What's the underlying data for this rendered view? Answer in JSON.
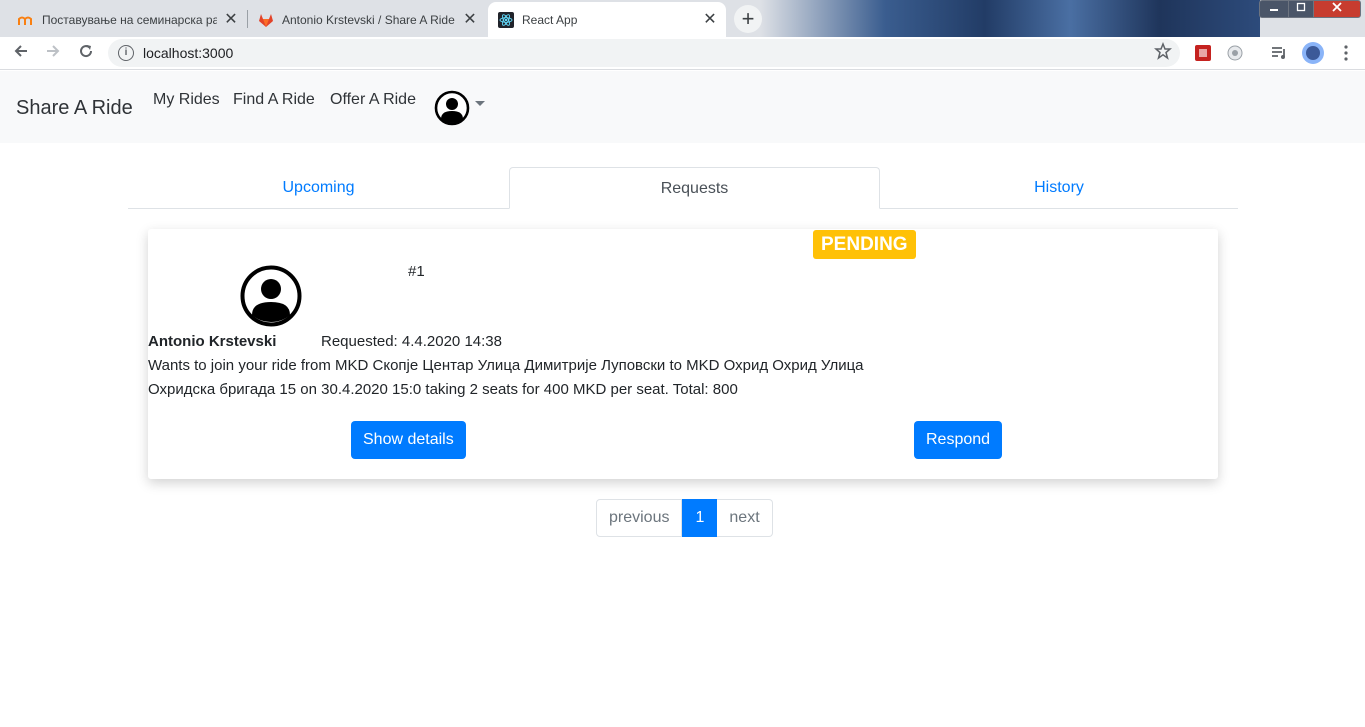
{
  "browser": {
    "tabs": [
      {
        "title": "Поставување на семинарска ра",
        "favicon": "moodle-icon",
        "active": false
      },
      {
        "title": "Antonio Krstevski / Share A Ride",
        "favicon": "gitlab-icon",
        "active": false
      },
      {
        "title": "React App",
        "favicon": "react-icon",
        "active": true
      }
    ],
    "new_tab": "+",
    "close_glyph": "✕",
    "url": "localhost:3000"
  },
  "navbar": {
    "brand": "Share A Ride",
    "links": [
      "My Rides",
      "Find A Ride",
      "Offer A Ride"
    ]
  },
  "tabs": [
    {
      "label": "Upcoming",
      "active": false
    },
    {
      "label": "Requests",
      "active": true
    },
    {
      "label": "History",
      "active": false
    }
  ],
  "request": {
    "status": "PENDING",
    "number": "#1",
    "name": "Antonio Krstevski",
    "requested": "Requested: 4.4.2020 14:38",
    "description": "Wants to join your ride from MKD Скопје Центар Улица Димитрије Луповски to MKD Охрид Охрид Улица Охридска бригада 15 on 30.4.2020 15:0 taking 2 seats for 400 MKD per seat. Total: 800",
    "show_details_label": "Show details",
    "respond_label": "Respond"
  },
  "pagination": {
    "previous": "previous",
    "current": "1",
    "next": "next"
  },
  "colors": {
    "primary": "#007bff",
    "warning": "#ffc107",
    "navbar_bg": "#f8f9fa"
  }
}
